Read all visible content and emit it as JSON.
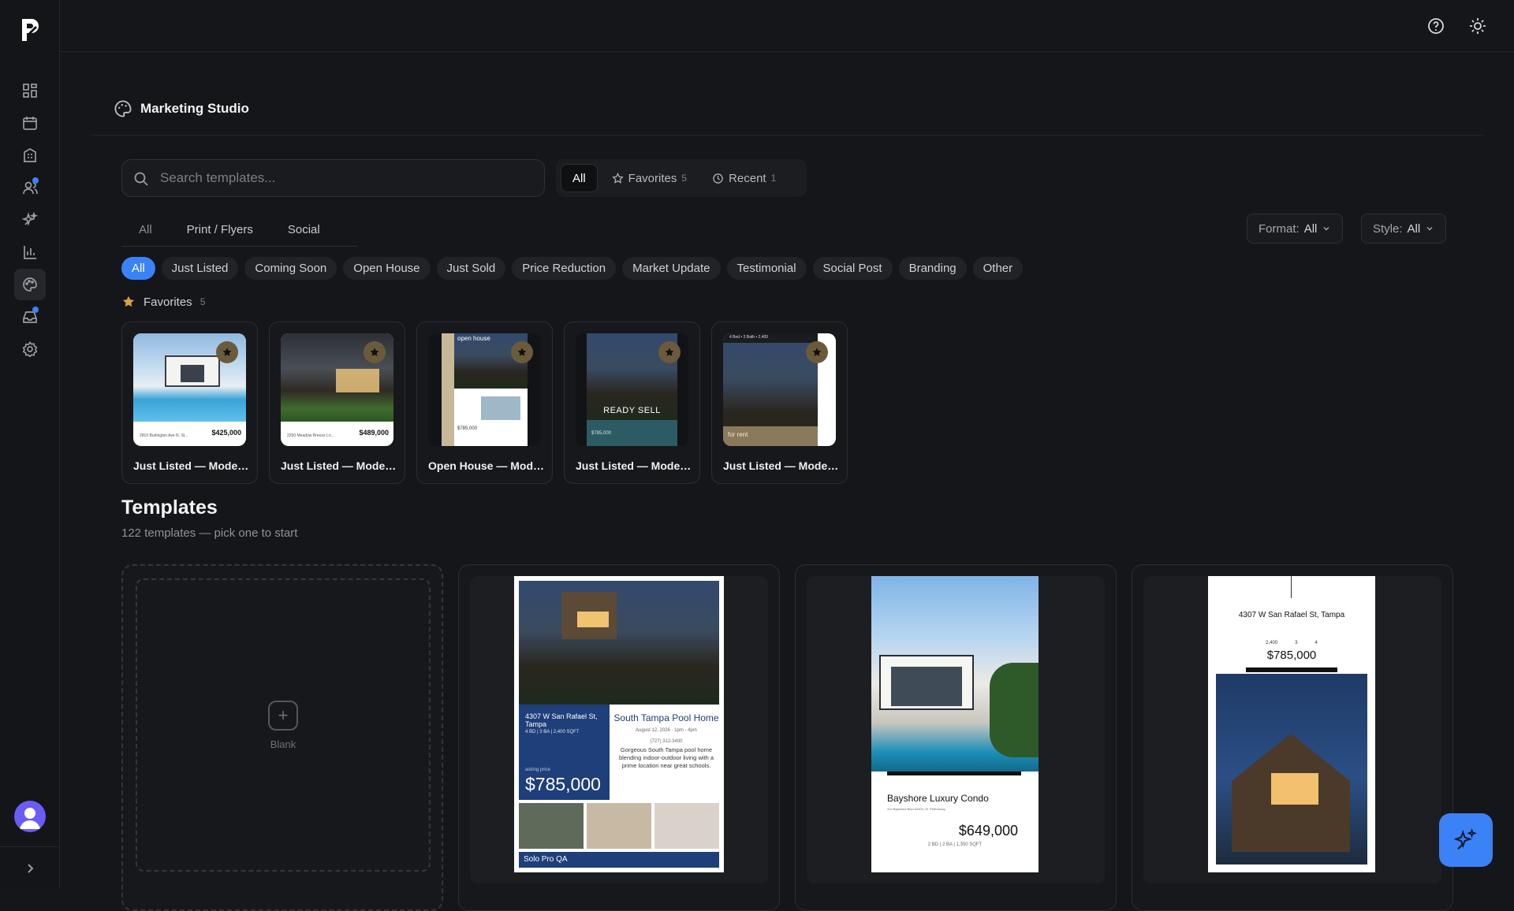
{
  "topbar": {
    "help_icon": "help-circle-icon",
    "theme_icon": "sun-icon"
  },
  "sidebar": {
    "items": [
      {
        "name": "dashboard-icon"
      },
      {
        "name": "calendar-icon"
      },
      {
        "name": "building-icon"
      },
      {
        "name": "users-icon",
        "dot": true
      },
      {
        "name": "sparkles-icon"
      },
      {
        "name": "bar-chart-icon"
      },
      {
        "name": "palette-icon",
        "active": true
      },
      {
        "name": "inbox-icon",
        "dot": true
      },
      {
        "name": "settings-icon"
      }
    ]
  },
  "page": {
    "title": "Marketing Studio"
  },
  "search": {
    "placeholder": "Search templates..."
  },
  "segments": {
    "all": "All",
    "favorites": "Favorites",
    "favorites_count": "5",
    "recent": "Recent",
    "recent_count": "1"
  },
  "format_tabs": [
    "All",
    "Print / Flyers",
    "Social"
  ],
  "filters": {
    "format_label": "Format:",
    "format_value": "All",
    "style_label": "Style:",
    "style_value": "All"
  },
  "categories": [
    "All",
    "Just Listed",
    "Coming Soon",
    "Open House",
    "Just Sold",
    "Price Reduction",
    "Market Update",
    "Testimonial",
    "Social Post",
    "Branding",
    "Other"
  ],
  "favorites": {
    "label": "Favorites",
    "count": "5",
    "items": [
      {
        "title": "Just Listed — Modern...",
        "price": "$425,000",
        "address": "2810 Burlington Ave N, St..."
      },
      {
        "title": "Just Listed — Modern...",
        "price": "$489,000",
        "address": "2250 Meadow Breeze Ln..."
      },
      {
        "title": "Open House — Modern...",
        "tag": "open house",
        "price": "$785,000"
      },
      {
        "title": "Just Listed — Modern...",
        "overlay": "READY SELL",
        "price": "$785,000"
      },
      {
        "title": "Just Listed — Modern...",
        "header": "4 Bed • 3 Bath • 2,400",
        "tag": "for rent"
      }
    ]
  },
  "templates": {
    "title": "Templates",
    "subtitle": "122 templates — pick one to start",
    "blank_label": "Blank",
    "cards": [
      {
        "address": "4307 W San Rafael St, Tampa",
        "headline": "South Tampa Pool Home",
        "specs": "4 BD | 3 BA | 2,400 SQFT",
        "date": "August 12, 2026 · 1pm - 4pm",
        "phone": "(727) 312-3400",
        "description": "Gorgeous South Tampa pool home blending indoor-outdoor living with a prime location near great schools.",
        "price_label": "asking price",
        "price": "$785,000",
        "brand": "Solo Pro QA"
      },
      {
        "name": "Bayshore Luxury Condo",
        "address": "412 Bayshore Blvd #1504, St. Petersburg",
        "price": "$649,000",
        "specs": "2 BD | 2 BA | 1,350 SQFT"
      },
      {
        "address": "4307 W San Rafael St, Tampa",
        "stats": [
          "2,400",
          "3",
          "4"
        ],
        "price": "$785,000"
      }
    ]
  }
}
